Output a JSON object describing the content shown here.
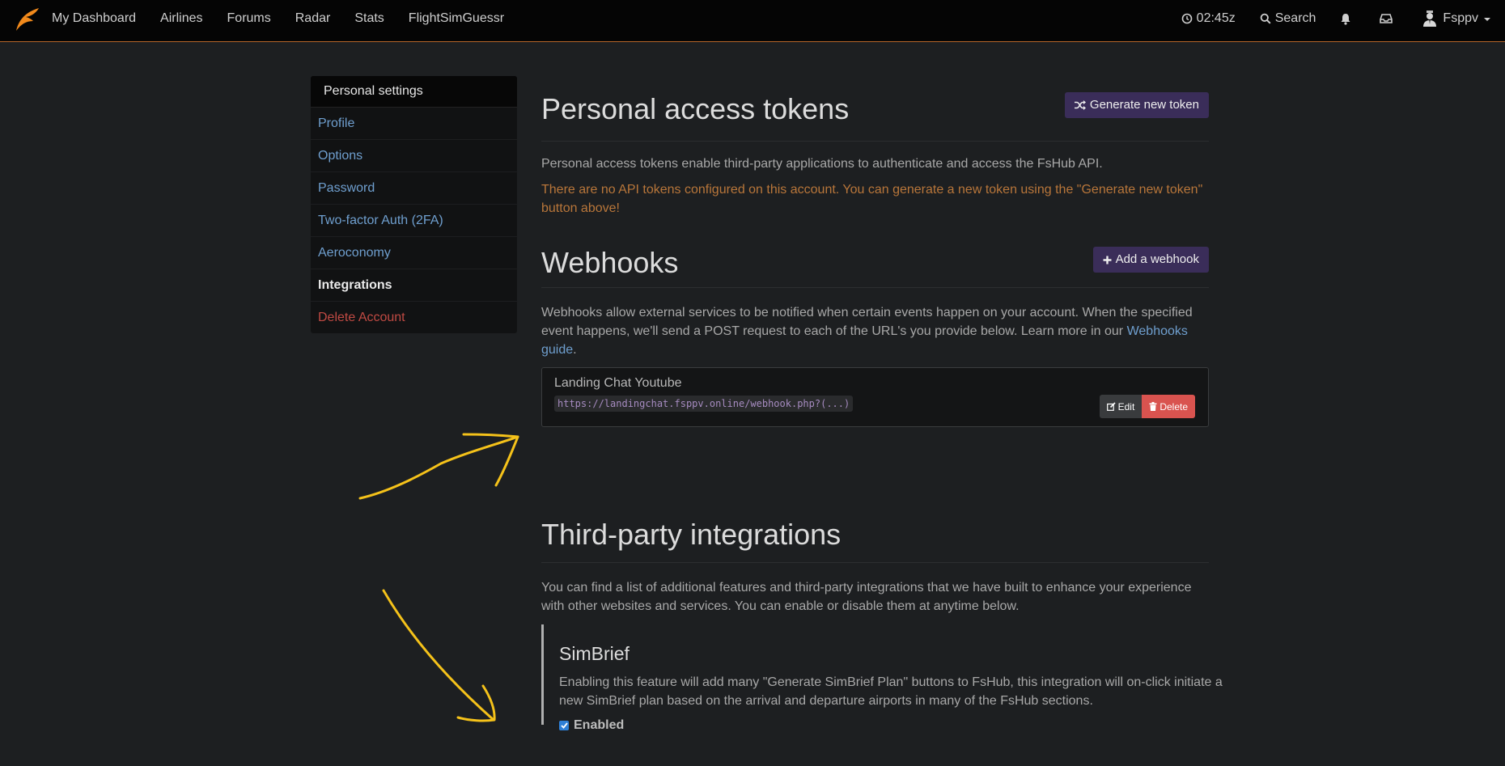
{
  "navbar": {
    "links": [
      "My Dashboard",
      "Airlines",
      "Forums",
      "Radar",
      "Stats",
      "FlightSimGuessr"
    ],
    "time": "02:45z",
    "search_label": "Search",
    "user_name": "Fsppv",
    "icons": [
      "logo-icon",
      "clock-icon",
      "search-icon",
      "bell-icon",
      "inbox-icon",
      "user-avatar-icon"
    ]
  },
  "sidebar": {
    "header": "Personal settings",
    "items": [
      {
        "label": "Profile"
      },
      {
        "label": "Options"
      },
      {
        "label": "Password"
      },
      {
        "label": "Two-factor Auth (2FA)"
      },
      {
        "label": "Aeroconomy"
      },
      {
        "label": "Integrations"
      },
      {
        "label": "Delete Account"
      }
    ]
  },
  "tokens": {
    "title": "Personal access tokens",
    "button_label": "Generate new token",
    "description": "Personal access tokens enable third-party applications to authenticate and access the FsHub API.",
    "warning": "There are no API tokens configured on this account. You can generate a new token using the \"Generate new token\" button above!"
  },
  "webhooks": {
    "title": "Webhooks",
    "button_label": "Add a webhook",
    "description_pre": "Webhooks allow external services to be notified when certain events happen on your account. When the specified event happens, we'll send a POST request to each of the URL's you provide below. Learn more in our ",
    "guide_link": "Webhooks guide",
    "description_post": ".",
    "items": [
      {
        "name": "Landing Chat Youtube",
        "url": "https://landingchat.fsppv.online/webhook.php?(...)",
        "edit_label": "Edit",
        "delete_label": "Delete"
      }
    ]
  },
  "integrations": {
    "title": "Third-party integrations",
    "description": "You can find a list of additional features and third-party integrations that we have built to enhance your experience with other websites and services. You can enable or disable them at anytime below.",
    "simbrief": {
      "title": "SimBrief",
      "description": "Enabling this feature will add many \"Generate SimBrief Plan\" buttons to FsHub, this integration will on-click initiate a new SimBrief plan based on the arrival and departure airports in many of the FsHub sections.",
      "checkbox_label": "Enabled",
      "checked": true
    }
  },
  "colors": {
    "accent_purple": "#3a2d59",
    "link_blue": "#6f9fcf",
    "danger_red": "#d9534f",
    "warning_orange": "#b8763a",
    "annotation_yellow": "#f5c21a"
  }
}
